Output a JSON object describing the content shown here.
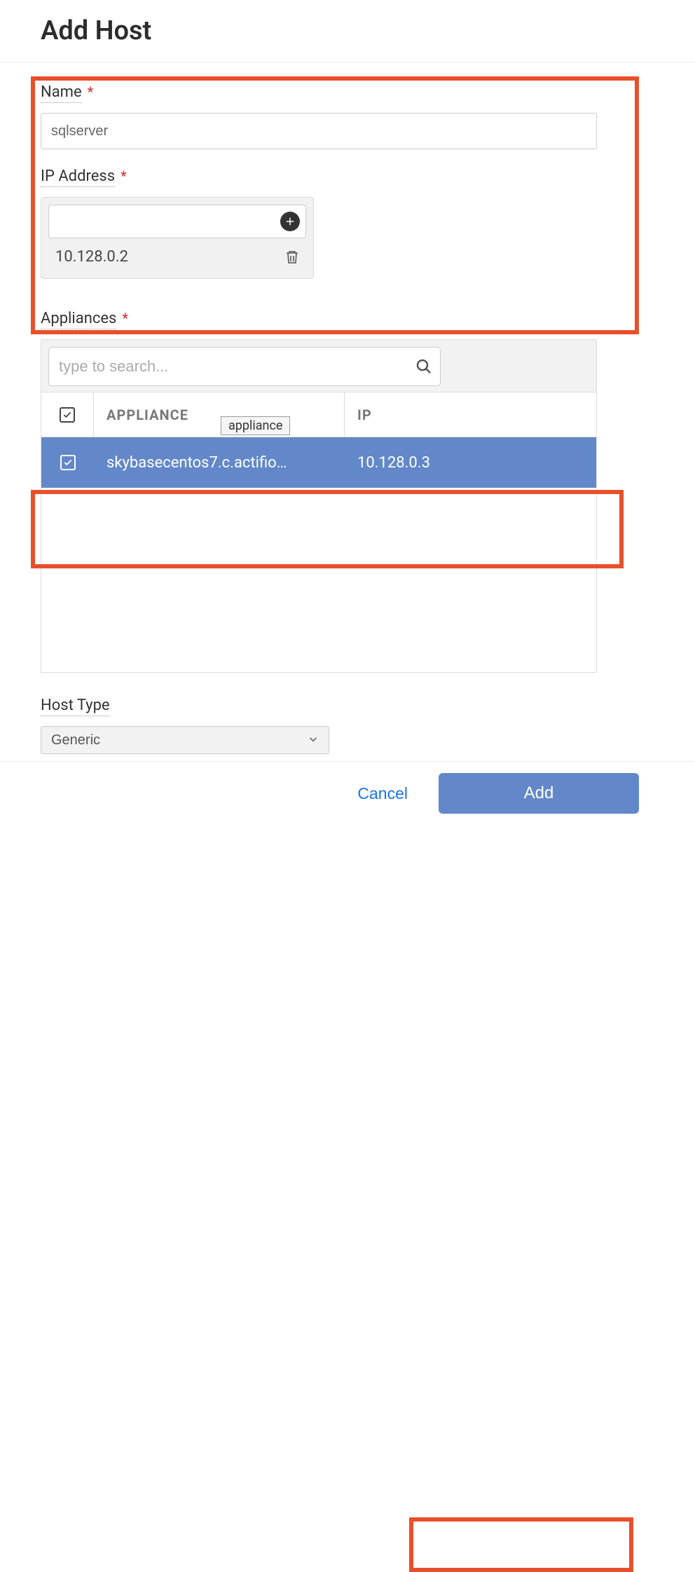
{
  "page": {
    "title": "Add Host"
  },
  "name": {
    "label": "Name",
    "value": "sqlserver"
  },
  "ip": {
    "label": "IP Address",
    "input": "",
    "entries": [
      "10.128.0.2"
    ]
  },
  "appliances": {
    "label": "Appliances",
    "search_placeholder": "type to search...",
    "columns": {
      "appliance": "APPLIANCE",
      "ip": "IP"
    },
    "tooltip": "appliance",
    "rows": [
      {
        "name": "skybasecentos7.c.actifio…",
        "ip": "10.128.0.3",
        "checked": true
      }
    ]
  },
  "host_type": {
    "label": "Host Type",
    "value": "Generic"
  },
  "footer": {
    "cancel": "Cancel",
    "add": "Add"
  }
}
